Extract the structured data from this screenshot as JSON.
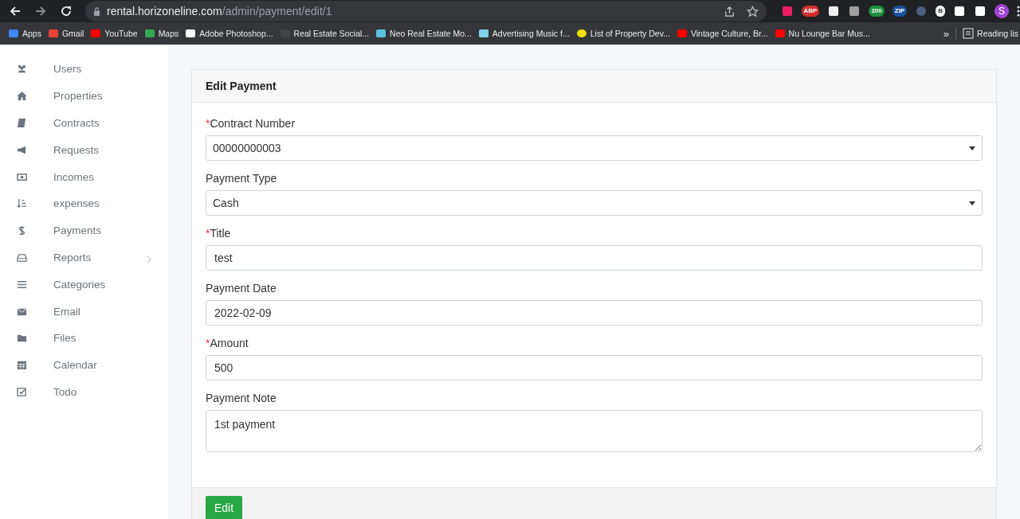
{
  "browser": {
    "url_host": "rental.horizoneline.com",
    "url_path": "/admin/payment/edit/1",
    "extensions": [
      {
        "kind": "icon"
      },
      {
        "kind": "badge",
        "text": "ABP"
      },
      {
        "kind": "icon"
      },
      {
        "kind": "icon"
      },
      {
        "kind": "badge",
        "text": "200"
      },
      {
        "kind": "badge",
        "text": "ZIP"
      },
      {
        "kind": "icon"
      },
      {
        "kind": "badge",
        "text": "B"
      },
      {
        "kind": "icon"
      },
      {
        "kind": "icon"
      }
    ],
    "profile": "S"
  },
  "bookmarks": {
    "items": [
      {
        "label": "Apps"
      },
      {
        "label": "Gmail"
      },
      {
        "label": "YouTube"
      },
      {
        "label": "Maps"
      },
      {
        "label": "Adobe Photoshop..."
      },
      {
        "label": "Real Estate Social..."
      },
      {
        "label": "Neo Real Estate Mo..."
      },
      {
        "label": "Advertising Music f..."
      },
      {
        "label": "List of Property Dev..."
      },
      {
        "label": "Vintage Culture, Br..."
      },
      {
        "label": "Nu Lounge Bar Mus..."
      }
    ],
    "overflow": "»",
    "reading_list": "Reading lis"
  },
  "sidebar": {
    "items": [
      {
        "label": "Users",
        "submenu": false
      },
      {
        "label": "Properties",
        "submenu": false
      },
      {
        "label": "Contracts",
        "submenu": false
      },
      {
        "label": "Requests",
        "submenu": false
      },
      {
        "label": "Incomes",
        "submenu": false
      },
      {
        "label": "expenses",
        "submenu": false
      },
      {
        "label": "Payments",
        "submenu": false
      },
      {
        "label": "Reports",
        "submenu": true
      },
      {
        "label": "Categories",
        "submenu": false
      },
      {
        "label": "Email",
        "submenu": false
      },
      {
        "label": "Files",
        "submenu": false
      },
      {
        "label": "Calendar",
        "submenu": false
      },
      {
        "label": "Todo",
        "submenu": false
      }
    ]
  },
  "card": {
    "title": "Edit Payment",
    "fields": [
      {
        "label": "Contract Number",
        "required": true,
        "kind": "select",
        "value": "00000000003"
      },
      {
        "label": "Payment Type",
        "required": false,
        "kind": "select",
        "value": "Cash"
      },
      {
        "label": "Title",
        "required": true,
        "kind": "input",
        "value": "test"
      },
      {
        "label": "Payment Date",
        "required": false,
        "kind": "input",
        "value": "2022-02-09"
      },
      {
        "label": "Amount",
        "required": true,
        "kind": "input",
        "value": "500"
      },
      {
        "label": "Payment Note",
        "required": false,
        "kind": "textarea",
        "value": "1st payment"
      }
    ],
    "required_mark": "*",
    "submit": "Edit"
  }
}
